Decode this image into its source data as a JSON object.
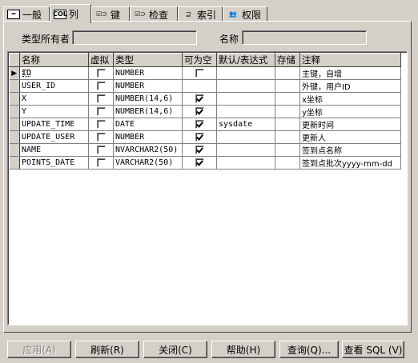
{
  "tabs": [
    {
      "label": "一般",
      "icon": "general-icon",
      "icon_text": "═"
    },
    {
      "label": "列",
      "icon": "columns-icon",
      "icon_text": "COL"
    },
    {
      "label": "键",
      "icon": "key-icon",
      "icon_text": "☑⊃"
    },
    {
      "label": "检查",
      "icon": "check-icon",
      "icon_text": "☑⊃"
    },
    {
      "label": "索引",
      "icon": "index-icon",
      "icon_text": "⊒"
    },
    {
      "label": "权限",
      "icon": "privileges-icon",
      "icon_text": "👥"
    }
  ],
  "form": {
    "type_owner_label": "类型所有者",
    "type_owner_value": "",
    "name_label": "名称",
    "name_value": ""
  },
  "grid": {
    "headers": [
      "名称",
      "虚拟",
      "类型",
      "可为空",
      "默认/表达式",
      "存储",
      "注释"
    ],
    "rows": [
      {
        "name": "ID",
        "virtual": false,
        "type": "NUMBER",
        "nullable": false,
        "default": "",
        "storage": "",
        "comment": "主键，自增"
      },
      {
        "name": "USER_ID",
        "virtual": false,
        "type": "NUMBER",
        "nullable": false,
        "default": "",
        "storage": "",
        "comment": "外键，用户ID"
      },
      {
        "name": "X",
        "virtual": false,
        "type": "NUMBER(14,6)",
        "nullable": true,
        "default": "",
        "storage": "",
        "comment": "x坐标"
      },
      {
        "name": "Y",
        "virtual": false,
        "type": "NUMBER(14,6)",
        "nullable": true,
        "default": "",
        "storage": "",
        "comment": "y坐标"
      },
      {
        "name": "UPDATE_TIME",
        "virtual": false,
        "type": "DATE",
        "nullable": true,
        "default": "sysdate",
        "storage": "",
        "comment": "更新时间"
      },
      {
        "name": "UPDATE_USER",
        "virtual": false,
        "type": "NUMBER",
        "nullable": true,
        "default": "",
        "storage": "",
        "comment": "更新人"
      },
      {
        "name": "NAME",
        "virtual": false,
        "type": "NVARCHAR2(50)",
        "nullable": true,
        "default": "",
        "storage": "",
        "comment": "签到点名称"
      },
      {
        "name": "POINTS_DATE",
        "virtual": false,
        "type": "VARCHAR2(50)",
        "nullable": true,
        "default": "",
        "storage": "",
        "comment": "签到点批次yyyy-mm-dd"
      }
    ]
  },
  "buttons": {
    "apply": "应用(A)",
    "refresh": "刷新(R)",
    "close": "关闭(C)",
    "help": "帮助(H)",
    "query": "查询(Q)...",
    "view_sql": "查看 SQL (V)"
  }
}
